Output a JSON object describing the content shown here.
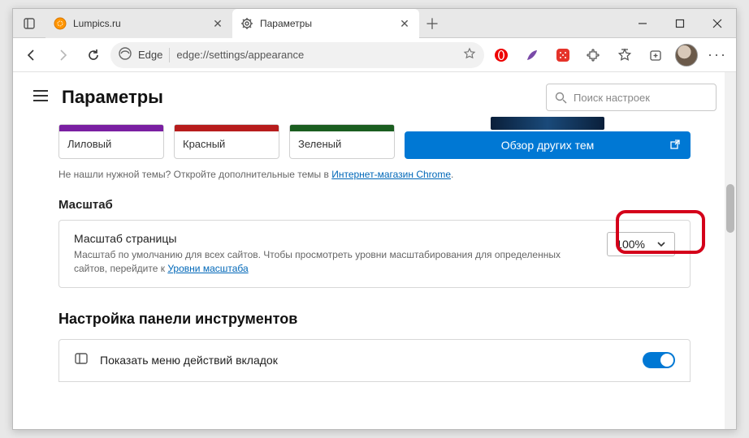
{
  "tabs": [
    {
      "title": "Lumpics.ru",
      "favicon": "orange-circle"
    },
    {
      "title": "Параметры",
      "favicon": "gear"
    }
  ],
  "address": {
    "scheme_label": "Edge",
    "url": "edge://settings/appearance"
  },
  "page": {
    "title": "Параметры",
    "search_placeholder": "Поиск настроек"
  },
  "themes": [
    {
      "name": "Лиловый",
      "color": "#7a1fa2"
    },
    {
      "name": "Красный",
      "color": "#b71c1c"
    },
    {
      "name": "Зеленый",
      "color": "#1b5e20"
    }
  ],
  "browse_themes_label": "Обзор других тем",
  "themes_help_prefix": "Не нашли нужной темы? Откройте дополнительные темы в ",
  "themes_help_link": "Интернет-магазин Chrome",
  "zoom": {
    "section_label": "Масштаб",
    "row_title": "Масштаб страницы",
    "row_desc_prefix": "Масштаб по умолчанию для всех сайтов. Чтобы просмотреть уровни масштабирования для определенных сайтов, перейдите к ",
    "row_desc_link": "Уровни масштаба",
    "value": "100%"
  },
  "toolbar_section": {
    "title": "Настройка панели инструментов",
    "row1_label": "Показать меню действий вкладок"
  }
}
